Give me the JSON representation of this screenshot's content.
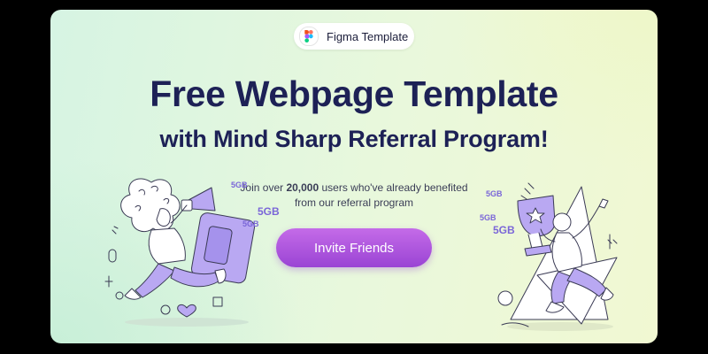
{
  "badge": {
    "label": "Figma Template",
    "icon": "figma-logo-icon",
    "colors": [
      "#f24e1e",
      "#ff7262",
      "#a259ff",
      "#1abcfe",
      "#0acf83"
    ]
  },
  "hero": {
    "title_line1": "Free Webpage Template",
    "title_line2": "with Mind Sharp Referral Program!",
    "subtitle_prefix": "Join over ",
    "subtitle_strong": "20,000",
    "subtitle_rest": " users who've already benefited from our referral program"
  },
  "cta": {
    "label": "Invite Friends",
    "gradient": [
      "#c46be8",
      "#9a44d4"
    ]
  },
  "illustrations": {
    "left": {
      "icon": "person-with-megaphone-illustration",
      "tags": [
        "5GB",
        "5GB",
        "5GB"
      ]
    },
    "right": {
      "icon": "person-with-trophy-illustration",
      "tags": [
        "5GB",
        "5GB",
        "5GB"
      ]
    }
  },
  "colors": {
    "title": "#1d2156",
    "accent": "#a259ff",
    "background_start": "#d6f4e3",
    "background_end": "#f1f8d2"
  }
}
